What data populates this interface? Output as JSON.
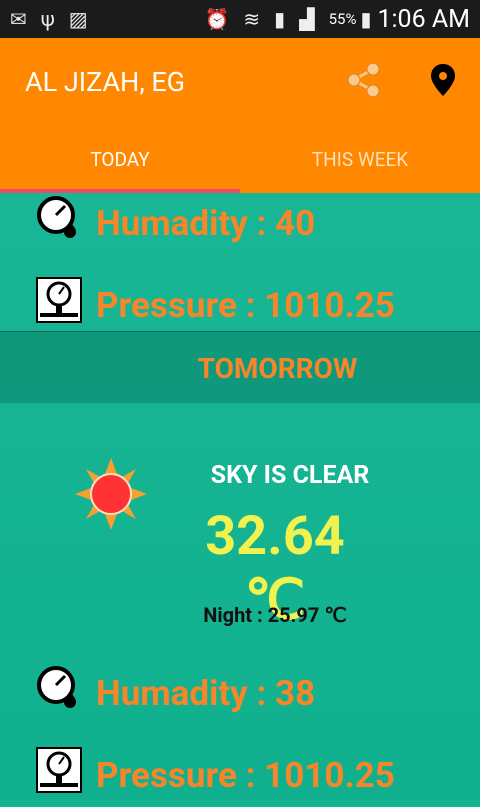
{
  "status_bar": {
    "battery": "55%",
    "time": "1:06 AM",
    "icons": [
      "mail-icon",
      "usb-icon",
      "image-icon",
      "alarm-icon",
      "wifi-icon",
      "sim-icon",
      "signal-icon",
      "battery-charging-icon"
    ]
  },
  "app_bar": {
    "title": "AL JIZAH, EG",
    "actions": [
      "share-icon",
      "location-pin-icon"
    ]
  },
  "tabs": [
    {
      "label": "TODAY",
      "active": true
    },
    {
      "label": "THIS WEEK",
      "active": false
    }
  ],
  "today": {
    "humidity": "Humadity : 40",
    "pressure": "Pressure : 1010.25"
  },
  "tomorrow": {
    "header": "TOMORROW",
    "condition": "SKY IS CLEAR",
    "icon": "sun-icon",
    "temperature": "32.64 ℃",
    "night": "Night : 25.97 ℃",
    "humidity": "Humadity : 38",
    "pressure": "Pressure : 1010.25"
  },
  "colors": {
    "app_bar": "#ff8800",
    "background": "#16b393",
    "accent_text": "#f7852a",
    "temperature": "#f2f24f",
    "tab_indicator": "#ee4a6a"
  }
}
